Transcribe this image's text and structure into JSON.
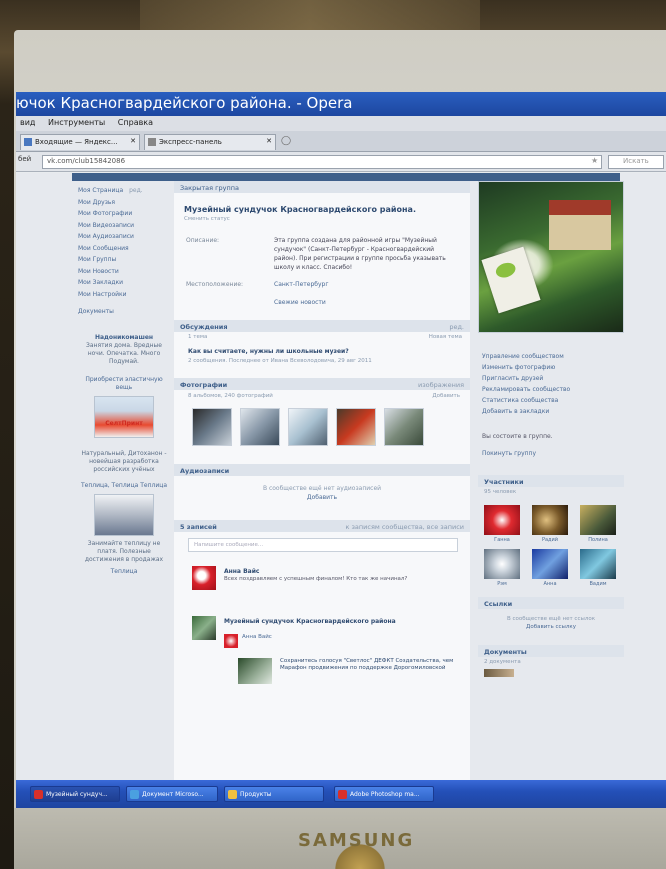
{
  "window": {
    "title": "ючок Красногвардейского района. - Opera"
  },
  "menubar": {
    "items": [
      "вид",
      "Инструменты",
      "Справка"
    ]
  },
  "tabs": [
    {
      "label": "Входящие — Яндекс..."
    },
    {
      "label": "Экспресс-панель"
    }
  ],
  "address": {
    "back": "бей",
    "url": "vk.com/club15842086",
    "search_placeholder": "Искать"
  },
  "left_menu": {
    "items": [
      {
        "label": "Моя Страница",
        "badge": "ред."
      },
      {
        "label": "Мои Друзья"
      },
      {
        "label": "Мои Фотографии"
      },
      {
        "label": "Мои Видеозаписи"
      },
      {
        "label": "Мои Аудиозаписи"
      },
      {
        "label": "Мои Сообщения"
      },
      {
        "label": "Мои Группы"
      },
      {
        "label": "Мои Новости"
      },
      {
        "label": "Мои Закладки"
      },
      {
        "label": "Мои Настройки"
      },
      {
        "label": "Документы"
      }
    ],
    "ad1": {
      "title": "Надоникомашен",
      "text": "Занятия дома. Вредные ночи. Опечатка. Много Подумай.",
      "link": "Приобрести эластичную вещь",
      "brand": "СелтПринт"
    },
    "ad2": {
      "text": "Натуральный, Дитоханон - новейшая разработка российских учёных",
      "link": "Теплица, Теплица Теплица",
      "caption": "Занимайте теплицу не платя. Полезные достижения в продажах",
      "more": "Теплица"
    }
  },
  "group": {
    "type_label": "Закрытая группа",
    "name": "Музейный сундучок Красногвардейского района.",
    "subtitle": "Сменить статус",
    "description_label": "Описание:",
    "description": "Эта группа создана для районной игры \"Музейный сундучок\" (Санкт-Петербург - Красногвардейский район). При регистрации в группе просьба указывать школу и класс. Спасибо!",
    "location_label": "Местоположение:",
    "location": "Санкт-Петербург",
    "news_link": "Свежие новости"
  },
  "discussions": {
    "title": "Обсуждения",
    "meta": "ред.",
    "count": "1 тема",
    "new_topic": "Новая тема",
    "topic": "Как вы считаете, нужны ли школьные музеи?",
    "last": "2 сообщения. Последнее от Ивана Всеволодовича, 29 авг 2011"
  },
  "photos": {
    "title": "Фотографии",
    "meta": "изображения",
    "sub": "8 альбомов, 240 фотографий",
    "add": "Добавить"
  },
  "audio": {
    "title": "Аудиозаписи",
    "empty": "В сообществе ещё нет аудиозаписей",
    "add": "Добавить"
  },
  "wall": {
    "title": "5 записей",
    "meta": "к записям сообщества, все записи",
    "input_placeholder": "Напишите сообщение...",
    "post1": {
      "author": "Анна Вайс",
      "text": "Всех поздравляем с успешным финалом! Кто так же начинал?"
    },
    "post2": {
      "author": "Музейный сундучок Красногвардейского района",
      "sub_author": "Анна Вайс",
      "attach_text": "Сохранитесь голосуя \"Светлос\" ДЕФКТ Создательства, чем Марафон продвижения по поддержке Дорогомиловской"
    }
  },
  "right": {
    "actions": [
      "Управление сообществом",
      "Изменить фотографию",
      "Пригласить друзей",
      "Рекламировать сообщество",
      "Статистика сообщества",
      "Добавить в закладки"
    ],
    "member_status": "Вы состоите в группе.",
    "leave": "Покинуть группу",
    "members_title": "Участники",
    "members_count": "95 человек",
    "members": [
      {
        "name": "Ганна"
      },
      {
        "name": "Радий"
      },
      {
        "name": "Полина"
      },
      {
        "name": "Рэм"
      },
      {
        "name": "Анна"
      },
      {
        "name": "Вадим"
      }
    ],
    "links_title": "Ссылки",
    "links_empty": "В сообществе ещё нет ссылок",
    "links_add": "Добавить ссылку",
    "docs_title": "Документы",
    "docs_count": "2 документа"
  },
  "taskbar": {
    "tasks": [
      "Музейный сундуч...",
      "Документ Microso...",
      "Продукты",
      "Adobe Photoshop ma..."
    ]
  },
  "monitor": {
    "brand": "SAMSUNG"
  }
}
